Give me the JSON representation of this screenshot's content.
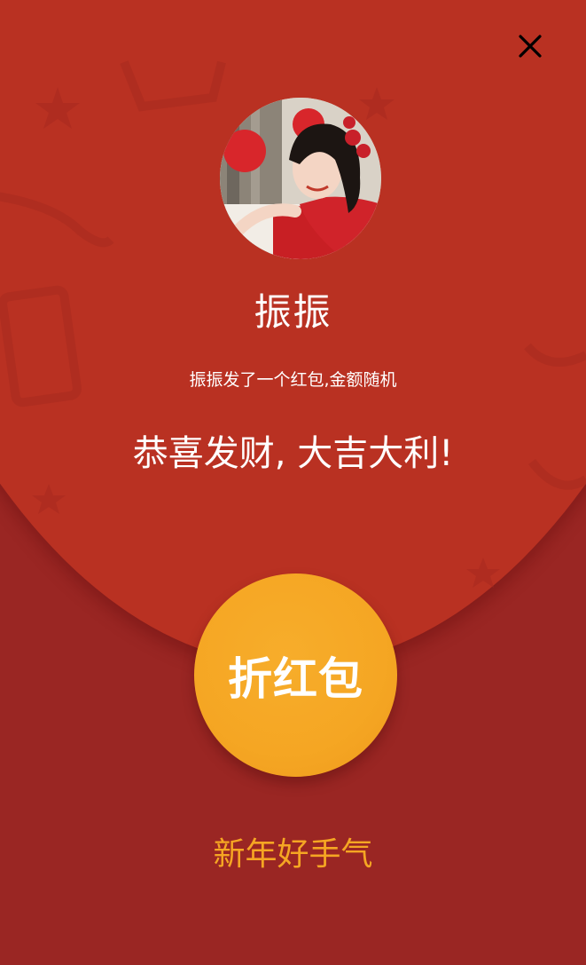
{
  "envelope": {
    "sender_name": "振振",
    "subtitle": "振振发了一个红包,金额随机",
    "greeting": "恭喜发财, 大吉大利!",
    "open_button_label": "折红包",
    "footer_text": "新年好手气"
  },
  "icons": {
    "close": "close-icon",
    "avatar": "avatar-photo"
  },
  "colors": {
    "top_flap": "#b93122",
    "bottom": "#9a2623",
    "button": "#f5a623",
    "footer_text": "#f5a623",
    "text": "#ffffff"
  }
}
